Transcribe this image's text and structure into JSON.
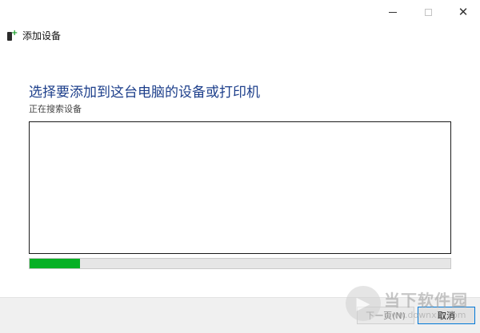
{
  "window": {
    "caption": {
      "minimize_icon": "minimize-icon",
      "maximize_icon": "maximize-icon",
      "close_symbol": "✕"
    }
  },
  "wizard": {
    "title": "添加设备",
    "heading": "选择要添加到这台电脑的设备或打印机",
    "status": "正在搜索设备",
    "progress_fraction": 0.12,
    "progress_color": "#06b025"
  },
  "footer": {
    "next_label": "下一页(N)",
    "cancel_label": "取消"
  },
  "watermark": {
    "name": "当下软件园",
    "url": "www.downxia.com"
  }
}
